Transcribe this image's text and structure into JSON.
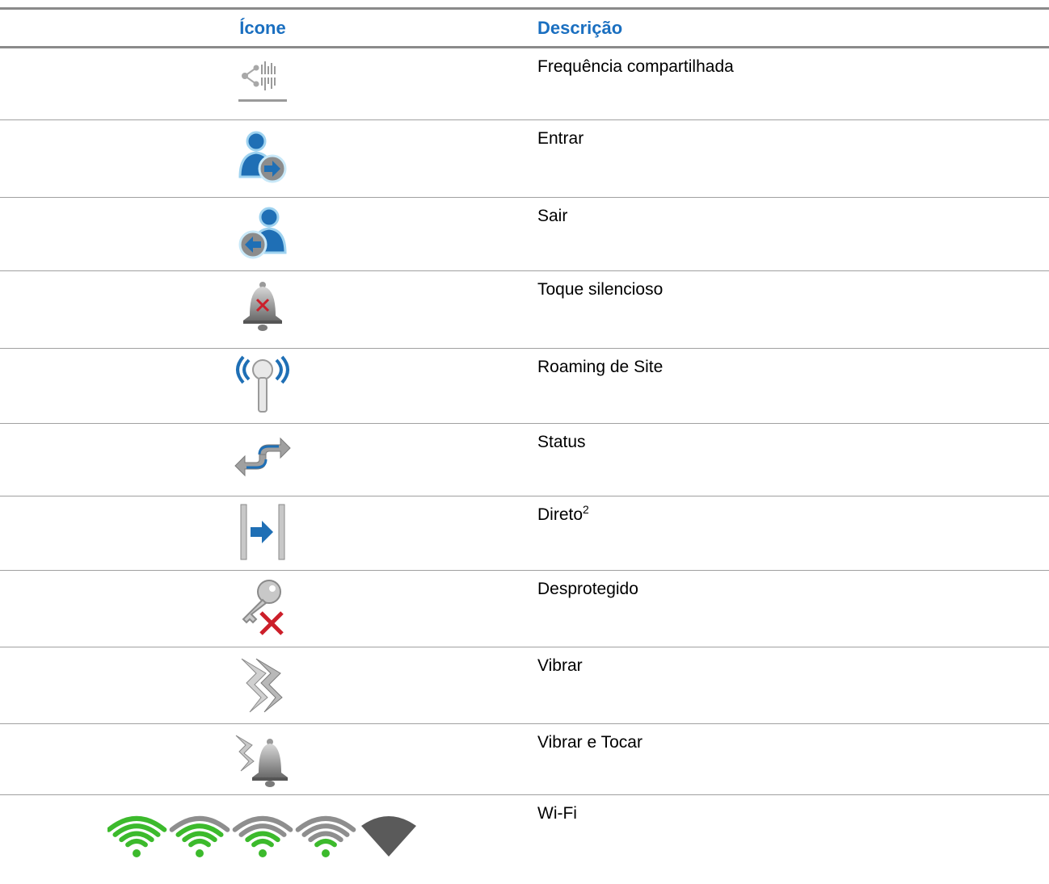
{
  "table": {
    "header": {
      "icon_col": "Ícone",
      "desc_col": "Descrição"
    },
    "rows": [
      {
        "icon": "shared-frequency-icon",
        "description": "Frequência compartilhada"
      },
      {
        "icon": "login-icon",
        "description": "Entrar"
      },
      {
        "icon": "logout-icon",
        "description": "Sair"
      },
      {
        "icon": "silent-ring-icon",
        "description": "Toque silencioso"
      },
      {
        "icon": "site-roaming-icon",
        "description": "Roaming de Site"
      },
      {
        "icon": "status-icon",
        "description": "Status"
      },
      {
        "icon": "direct-icon",
        "description": "Direto",
        "footnote": "2"
      },
      {
        "icon": "unsecure-icon",
        "description": "Desprotegido"
      },
      {
        "icon": "vibrate-icon",
        "description": "Vibrar"
      },
      {
        "icon": "vibrate-and-ring-icon",
        "description": "Vibrar e Tocar"
      },
      {
        "icon": "wifi-icon",
        "description": "Wi-Fi",
        "wifi_levels": [
          4,
          3,
          2,
          1,
          0
        ]
      }
    ]
  },
  "colors": {
    "header_text": "#1a6fc0",
    "wifi_green": "#3cba2c",
    "icon_gray": "#9a9a9a",
    "icon_blue": "#1f6fb5",
    "cross_red": "#cc1f2a"
  }
}
